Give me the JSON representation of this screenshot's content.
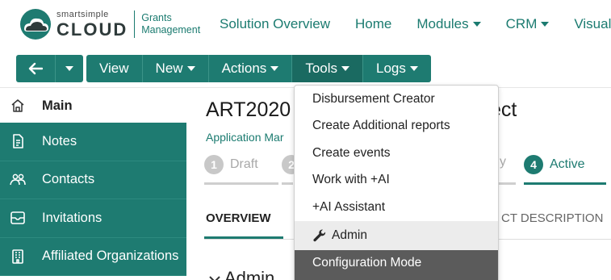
{
  "header": {
    "logo_small": "smartsimple",
    "logo_big": "CLOUD",
    "logo_line1": "Grants",
    "logo_line2": "Management",
    "nav": [
      {
        "label": "Solution Overview",
        "caret": false
      },
      {
        "label": "Home",
        "caret": false
      },
      {
        "label": "Modules",
        "caret": true
      },
      {
        "label": "CRM",
        "caret": true
      },
      {
        "label": "Visuals",
        "caret": false
      }
    ]
  },
  "toolbar": {
    "view": "View",
    "new": "New",
    "actions": "Actions",
    "tools": "Tools",
    "logs": "Logs"
  },
  "sidebar": {
    "items": [
      {
        "label": "Main",
        "icon": "home-icon"
      },
      {
        "label": "Notes",
        "icon": "document-icon"
      },
      {
        "label": "Contacts",
        "icon": "people-icon"
      },
      {
        "label": "Invitations",
        "icon": "invitation-icon"
      },
      {
        "label": "Affiliated Organizations",
        "icon": "building-icon"
      }
    ]
  },
  "content": {
    "title_start": "ART2020",
    "title_end": "ect",
    "sublink": "Application Mar",
    "steps": [
      {
        "num": "1",
        "label": "Draft"
      },
      {
        "num": "2",
        "label": ""
      },
      {
        "num": "",
        "label": "y"
      },
      {
        "num": "4",
        "label": "Active"
      }
    ],
    "tabs": {
      "overview": "OVERVIEW",
      "description": "CT DESCRIPTION"
    },
    "section_head": "Admin"
  },
  "dropdown": {
    "items": [
      {
        "label": "Disbursement Creator"
      },
      {
        "label": "Create Additional reports"
      },
      {
        "label": "Create events"
      },
      {
        "label": "Work with +AI"
      },
      {
        "label": "+AI Assistant"
      },
      {
        "label": "Admin"
      },
      {
        "label": "Configuration Mode"
      }
    ]
  },
  "colors": {
    "brand": "#1e7b71",
    "step_inactive": "#cfcfcf",
    "dropdown_selected": "#5b5b5b"
  }
}
